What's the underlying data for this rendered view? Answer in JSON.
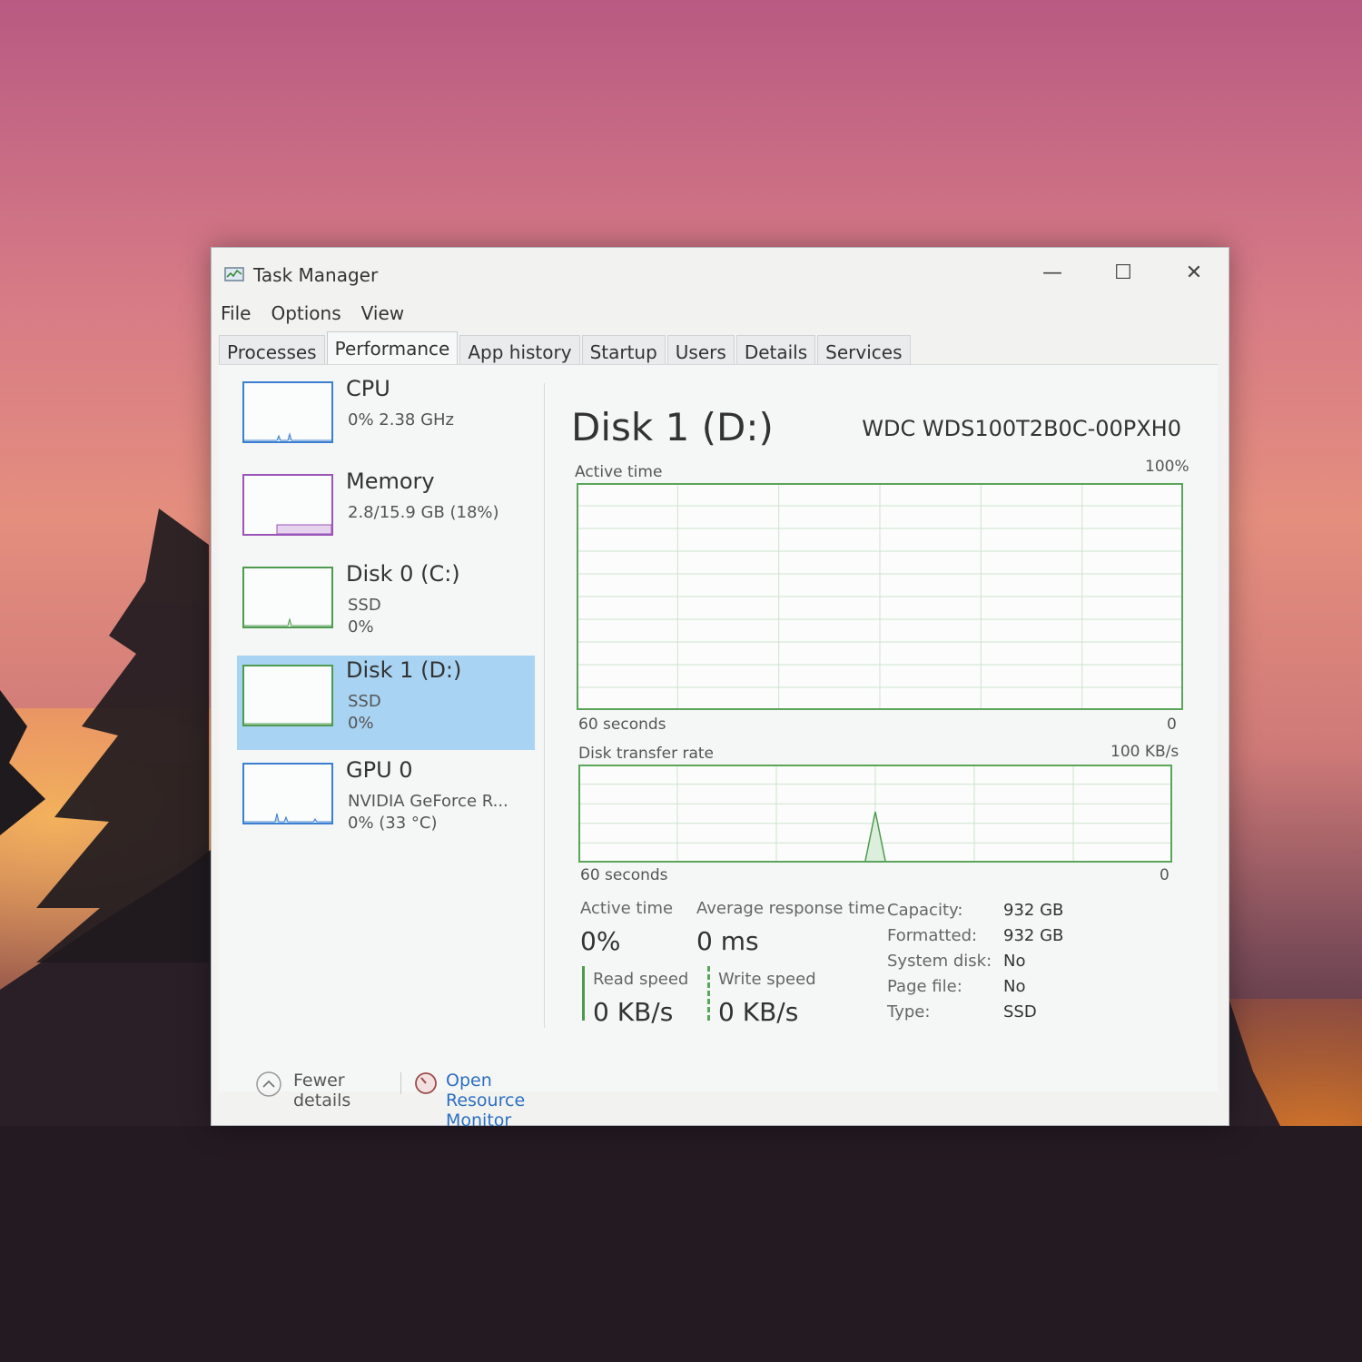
{
  "window": {
    "title": "Task Manager",
    "controls": {
      "minimize": "—",
      "maximize": "☐",
      "close": "✕"
    }
  },
  "menu": [
    "File",
    "Options",
    "View"
  ],
  "tabs": [
    "Processes",
    "Performance",
    "App history",
    "Startup",
    "Users",
    "Details",
    "Services"
  ],
  "active_tab": "Performance",
  "sidebar": [
    {
      "title": "CPU",
      "lines": [
        "0%  2.38 GHz"
      ],
      "color": "#3b7fd0"
    },
    {
      "title": "Memory",
      "lines": [
        "2.8/15.9 GB (18%)"
      ],
      "color": "#9b55b8"
    },
    {
      "title": "Disk 0 (C:)",
      "lines": [
        "SSD",
        "0%"
      ],
      "color": "#4e9a4e"
    },
    {
      "title": "Disk 1 (D:)",
      "lines": [
        "SSD",
        "0%"
      ],
      "color": "#4e9a4e",
      "selected": true
    },
    {
      "title": "GPU 0",
      "lines": [
        "NVIDIA GeForce R...",
        "0%  (33 °C)"
      ],
      "color": "#3b7fd0"
    }
  ],
  "detail": {
    "title": "Disk 1 (D:)",
    "model": "WDC WDS100T2B0C-00PXH0",
    "active_graph": {
      "label": "Active time",
      "max": "100%",
      "time": "60 seconds",
      "min": "0"
    },
    "transfer_graph": {
      "label": "Disk transfer rate",
      "max": "100 KB/s",
      "time": "60 seconds",
      "min": "0"
    },
    "stats": {
      "active_time_label": "Active time",
      "active_time_value": "0%",
      "avg_resp_label": "Average response time",
      "avg_resp_value": "0 ms",
      "read_label": "Read speed",
      "read_value": "0 KB/s",
      "write_label": "Write speed",
      "write_value": "0 KB/s"
    },
    "properties": [
      {
        "key": "Capacity:",
        "value": "932 GB"
      },
      {
        "key": "Formatted:",
        "value": "932 GB"
      },
      {
        "key": "System disk:",
        "value": "No"
      },
      {
        "key": "Page file:",
        "value": "No"
      },
      {
        "key": "Type:",
        "value": "SSD"
      }
    ]
  },
  "footer": {
    "fewer_details": "Fewer details",
    "open_resource_monitor": "Open Resource Monitor"
  },
  "colors": {
    "disk_green": "#4e9a4e",
    "link_blue": "#2c6fc2",
    "selection": "#a9d3f2"
  }
}
